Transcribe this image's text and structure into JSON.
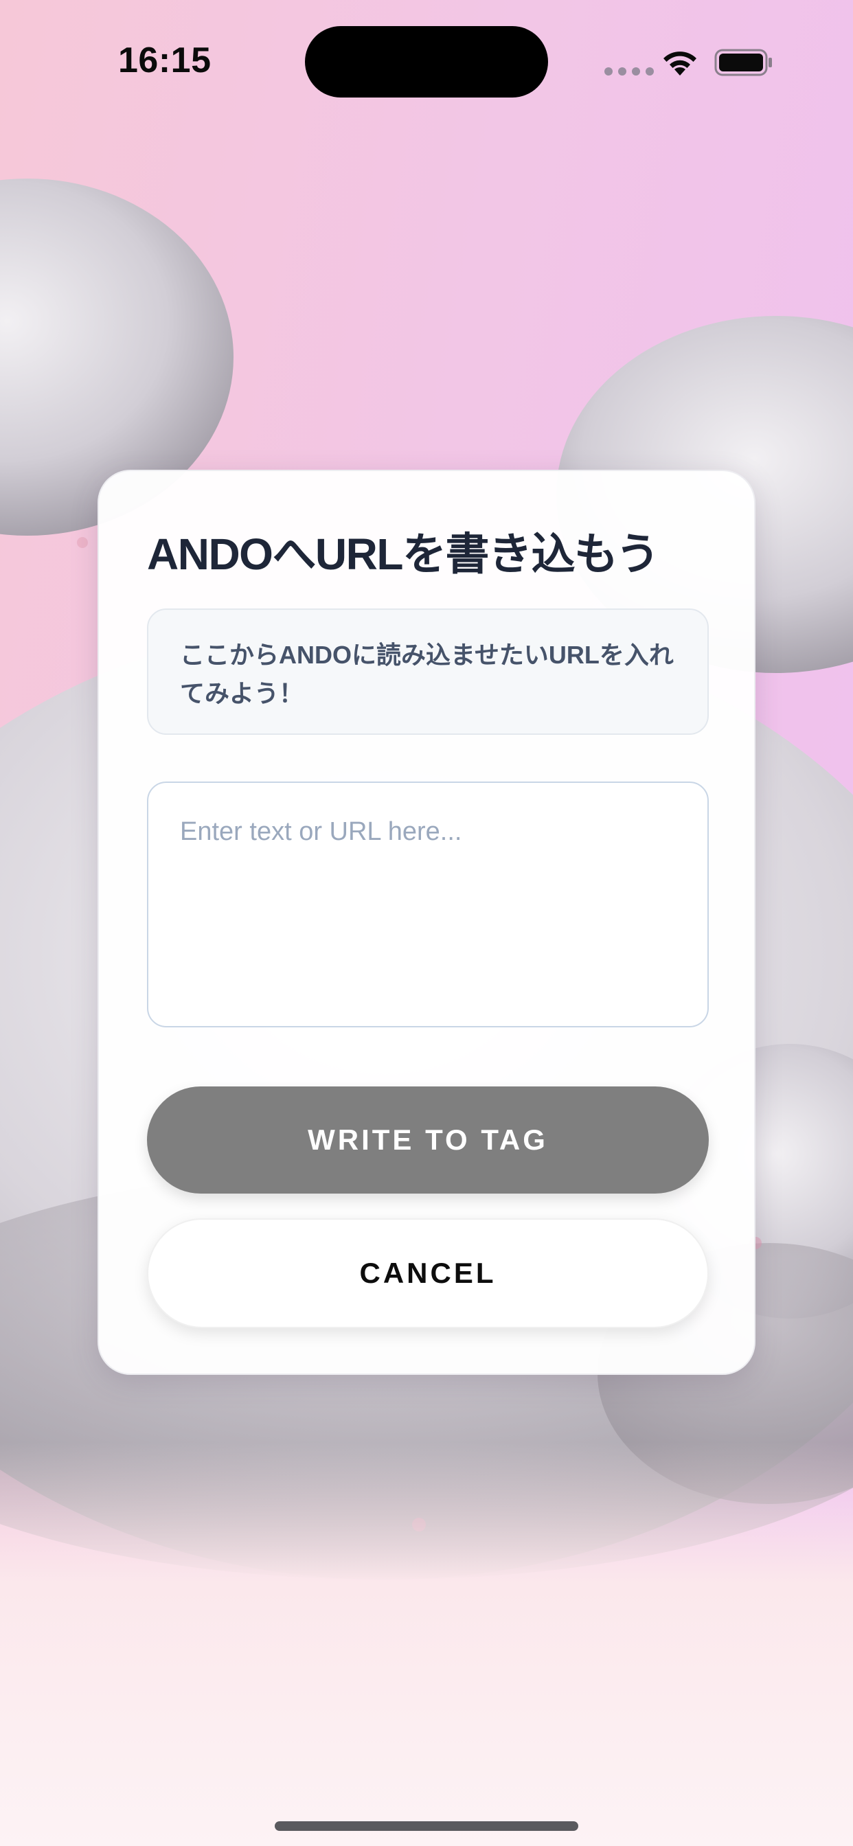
{
  "status_bar": {
    "time": "16:15"
  },
  "dialog": {
    "title": "ANDOへURLを書き込もう",
    "info_text": "ここからANDOに読み込ませたいURLを入れてみよう！",
    "input": {
      "value": "",
      "placeholder": "Enter text or URL here..."
    },
    "write_button_label": "WRITE TO TAG",
    "cancel_button_label": "CANCEL"
  },
  "icons": {
    "wifi": "wifi-icon",
    "battery": "battery-icon",
    "signal": "signal-dots-icon"
  },
  "colors": {
    "title_text": "#1e2638",
    "write_button_bg": "#7f7f7f",
    "input_border": "#c9d6e6",
    "background_left": "#f6c8d8",
    "background_right": "#efc0f0"
  }
}
